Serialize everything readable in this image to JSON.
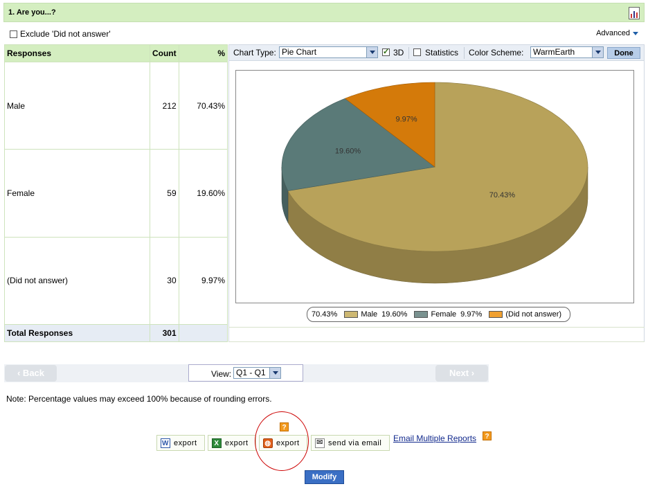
{
  "question": {
    "title": "1. Are you...?"
  },
  "exclude": {
    "label": "Exclude 'Did not answer'"
  },
  "advanced": {
    "label": "Advanced"
  },
  "table": {
    "headers": {
      "responses": "Responses",
      "count": "Count",
      "percent": "%"
    },
    "rows": [
      {
        "label": "Male",
        "count": "212",
        "percent": "70.43%"
      },
      {
        "label": "Female",
        "count": "59",
        "percent": "19.60%"
      },
      {
        "label": "(Did not answer)",
        "count": "30",
        "percent": "9.97%"
      }
    ],
    "total": {
      "label": "Total Responses",
      "count": "301"
    }
  },
  "chart_toolbar": {
    "chart_type_label": "Chart Type:",
    "chart_type_value": "Pie Chart",
    "three_d_label": "3D",
    "statistics_label": "Statistics",
    "color_scheme_label": "Color Scheme:",
    "color_scheme_value": "WarmEarth",
    "done_label": "Done"
  },
  "chart_data": {
    "type": "pie",
    "three_d": true,
    "categories": [
      "Male",
      "Female",
      "(Did not answer)"
    ],
    "values": [
      70.43,
      19.6,
      9.97
    ],
    "value_labels": [
      "70.43%",
      "19.60%",
      "9.97%"
    ],
    "colors": [
      "#b8a25a",
      "#5a7a78",
      "#d47a0a"
    ],
    "legend": [
      {
        "value": "70.43%",
        "name": "Male",
        "color": "#cdb873"
      },
      {
        "value": "19.60%",
        "name": "Female",
        "color": "#7a9290"
      },
      {
        "value": "9.97%",
        "name": "(Did not answer)",
        "color": "#f0a030"
      }
    ],
    "legend_position": "bottom"
  },
  "nav": {
    "back_label": "‹ Back",
    "next_label": "Next ›",
    "view_label": "View:",
    "view_value": "Q1 - Q1"
  },
  "note": "Note: Percentage values may exceed 100% because of rounding errors.",
  "export": {
    "word_label": "export",
    "excel_label": "export",
    "pdf_label": "export",
    "email_label": "send via email",
    "help_symbol": "?",
    "email_multiple_label": "Email Multiple Reports"
  },
  "modify_label": "Modify"
}
